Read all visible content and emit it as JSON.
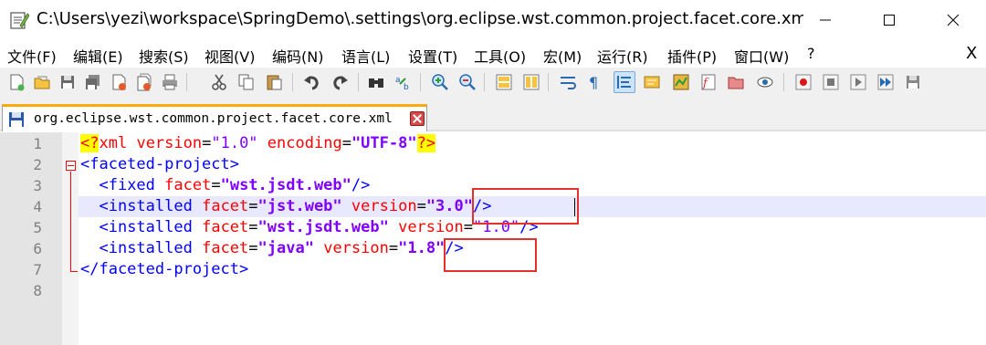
{
  "window": {
    "title": "C:\\Users\\yezi\\workspace\\SpringDemo\\.settings\\org.eclipse.wst.common.project.facet.core.xml - ..."
  },
  "menu": [
    "文件(F)",
    "编辑(E)",
    "搜索(S)",
    "视图(V)",
    "编码(N)",
    "语言(L)",
    "设置(T)",
    "工具(O)",
    "宏(M)",
    "运行(R)",
    "插件(P)",
    "窗口(W)",
    "?"
  ],
  "menu_close": "X",
  "toolbar_icons": [
    "new-file-icon",
    "open-file-icon",
    "save-icon",
    "save-all-icon",
    "close-icon",
    "close-all-icon",
    "print-icon",
    "cut-icon",
    "copy-icon",
    "paste-icon",
    "undo-icon",
    "redo-icon",
    "find-icon",
    "replace-icon",
    "zoom-in-icon",
    "zoom-out-icon",
    "sync-vertical-icon",
    "sync-horizontal-icon",
    "word-wrap-icon",
    "show-all-chars-icon",
    "indent-guide-icon",
    "lang-icon",
    "doc-map-icon",
    "function-list-icon",
    "folder-workspace-icon",
    "monitor-icon",
    "record-macro-icon",
    "stop-record-icon",
    "play-macro-icon",
    "run-macro-multiple-icon",
    "save-macro-icon"
  ],
  "tab": {
    "label": "org.eclipse.wst.common.project.facet.core.xml"
  },
  "editor": {
    "line_numbers": [
      "1",
      "2",
      "3",
      "4",
      "5",
      "6",
      "7",
      "8"
    ],
    "lines": {
      "l1": {
        "pi_open": "<?",
        "name": "xml",
        "a1": "version",
        "v1": "\"1.0\"",
        "a2": "encoding",
        "v2": "\"UTF-8\"",
        "pi_close": "?>"
      },
      "l2": {
        "tag": "<faceted-project>"
      },
      "l3": {
        "open": "<fixed",
        "a1": "facet",
        "v1": "\"wst.jsdt.web\"",
        "close": "/>"
      },
      "l4": {
        "open": "<installed",
        "a1": "facet",
        "v1": "\"jst.web\"",
        "a2": "version",
        "v2": "\"3.0\"",
        "close": "/>"
      },
      "l5": {
        "open": "<installed",
        "a1": "facet",
        "v1": "\"wst.jsdt.web\"",
        "a2": "version",
        "v2": "\"1.0\"",
        "close": "/>"
      },
      "l6": {
        "open": "<installed",
        "a1": "facet",
        "v1": "\"java\"",
        "a2": "version",
        "v2": "\"1.8\"",
        "close": "/>"
      },
      "l7": {
        "tag": "</faceted-project>"
      }
    },
    "eq": "="
  },
  "colors": {
    "tag": "#0000ff",
    "attribute": "#ff0000",
    "string": "#8000ff",
    "annotation_box": "#e53030",
    "current_line": "#e8e8ff"
  }
}
